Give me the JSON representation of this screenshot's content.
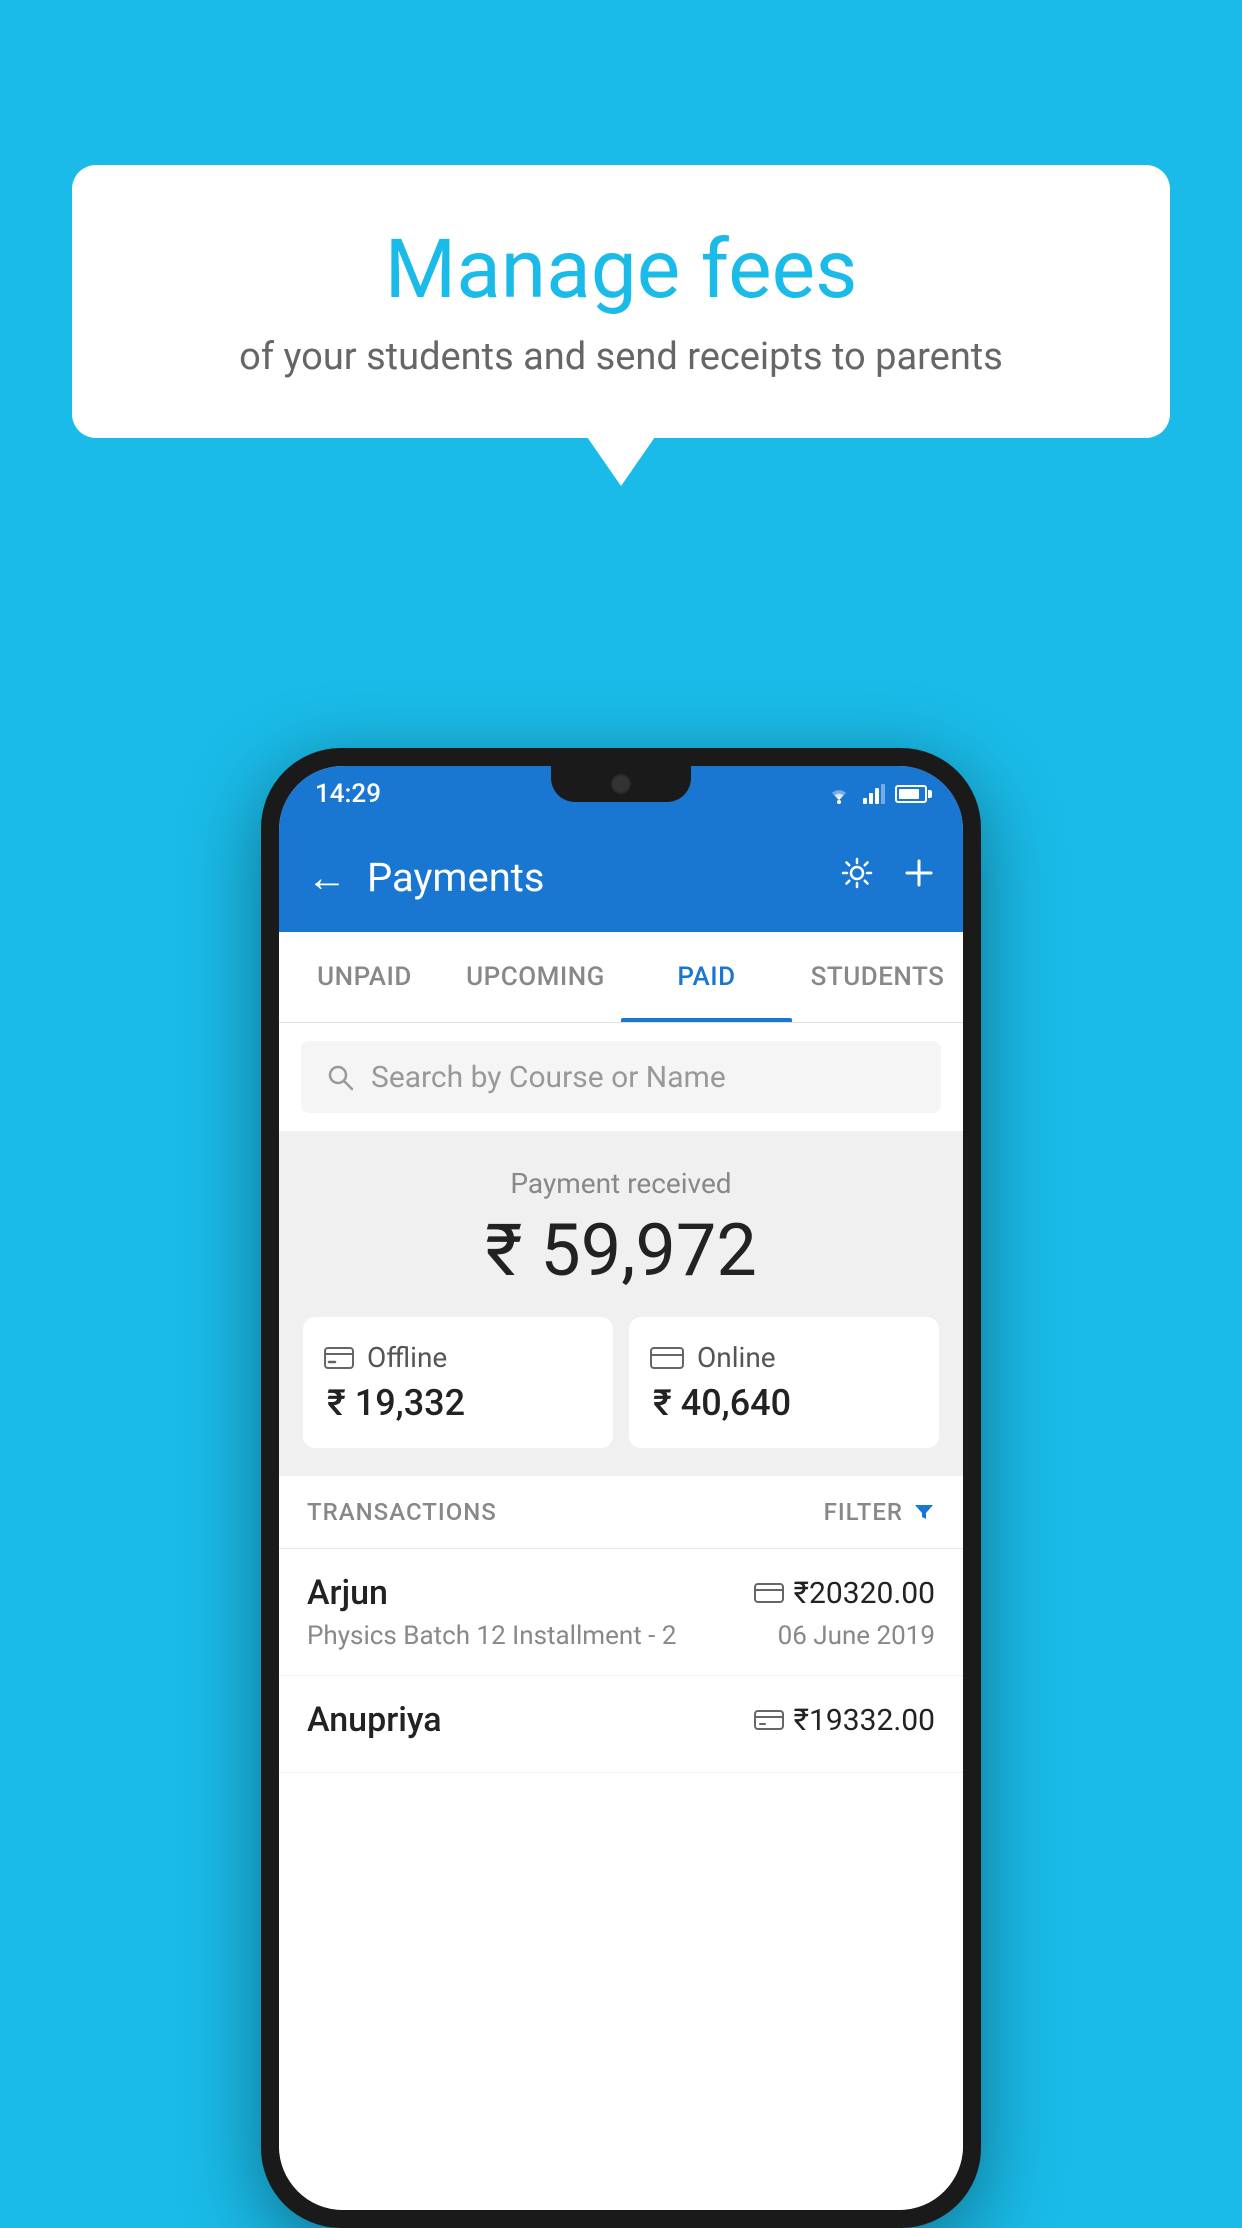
{
  "background_color": "#1abbe8",
  "bubble": {
    "title": "Manage fees",
    "subtitle": "of your students and send receipts to parents"
  },
  "status_bar": {
    "time": "14:29",
    "wifi_icon": "wifi",
    "signal_icon": "signal",
    "battery_icon": "battery"
  },
  "header": {
    "title": "Payments",
    "back_label": "←",
    "gear_label": "⚙",
    "plus_label": "+"
  },
  "tabs": [
    {
      "label": "UNPAID",
      "active": false
    },
    {
      "label": "UPCOMING",
      "active": false
    },
    {
      "label": "PAID",
      "active": true
    },
    {
      "label": "STUDENTS",
      "active": false
    }
  ],
  "search": {
    "placeholder": "Search by Course or Name"
  },
  "payment_summary": {
    "label": "Payment received",
    "amount": "₹ 59,972",
    "offline": {
      "label": "Offline",
      "amount": "₹ 19,332"
    },
    "online": {
      "label": "Online",
      "amount": "₹ 40,640"
    }
  },
  "transactions_header": {
    "label": "TRANSACTIONS",
    "filter_label": "FILTER"
  },
  "transactions": [
    {
      "name": "Arjun",
      "amount_icon": "💳",
      "amount": "₹20320.00",
      "description": "Physics Batch 12 Installment - 2",
      "date": "06 June 2019"
    },
    {
      "name": "Anupriya",
      "amount_icon": "🏧",
      "amount": "₹19332.00",
      "description": "",
      "date": ""
    }
  ]
}
